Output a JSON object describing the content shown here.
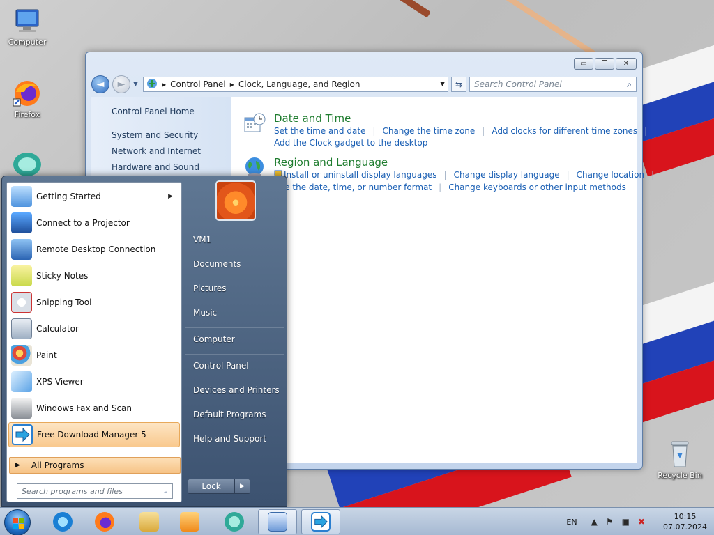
{
  "desktop": {
    "icons": [
      {
        "label": "Computer",
        "icon": "computer-monitor-icon"
      },
      {
        "label": "Firefox",
        "icon": "firefox-icon"
      },
      {
        "label": "Recycle Bin",
        "icon": "recycle-bin-icon"
      }
    ]
  },
  "window": {
    "caption_buttons": [
      "▭",
      "❐",
      "✕"
    ],
    "address": {
      "crumbs": [
        "Control Panel",
        "Clock, Language, and Region"
      ]
    },
    "search_placeholder": "Search Control Panel",
    "left_nav": [
      "Control Panel Home",
      "System and Security",
      "Network and Internet",
      "Hardware and Sound"
    ],
    "sections": [
      {
        "title": "Date and Time",
        "icon": "clock-calendar-icon",
        "rows": [
          [
            "Set the time and date",
            "Change the time zone",
            "Add clocks for different time zones"
          ],
          [
            "Add the Clock gadget to the desktop"
          ]
        ]
      },
      {
        "title": "Region and Language",
        "icon": "globe-icon",
        "rows": [
          [
            "Install or uninstall display languages",
            "Change display language",
            "Change location"
          ],
          [
            "nge the date, time, or number format",
            "Change keyboards or other input methods"
          ]
        ]
      }
    ]
  },
  "start_menu": {
    "programs": [
      {
        "label": "Getting Started",
        "has_submenu": true,
        "icon": "getting-started-icon"
      },
      {
        "label": "Connect to a Projector",
        "icon": "projector-icon"
      },
      {
        "label": "Remote Desktop Connection",
        "icon": "remote-desktop-icon"
      },
      {
        "label": "Sticky Notes",
        "icon": "sticky-notes-icon"
      },
      {
        "label": "Snipping Tool",
        "icon": "scissors-icon"
      },
      {
        "label": "Calculator",
        "icon": "calculator-icon"
      },
      {
        "label": "Paint",
        "icon": "paint-palette-icon"
      },
      {
        "label": "XPS Viewer",
        "icon": "xps-viewer-icon"
      },
      {
        "label": "Windows Fax and Scan",
        "icon": "fax-scanner-icon"
      },
      {
        "label": "Free Download Manager 5",
        "icon": "download-manager-icon",
        "highlighted": true
      }
    ],
    "all_programs": "All Programs",
    "search_placeholder": "Search programs and files",
    "right_items": [
      "VM1",
      "Documents",
      "Pictures",
      "Music",
      "Computer",
      "Control Panel",
      "Devices and Printers",
      "Default Programs",
      "Help and Support"
    ],
    "lock_label": "Lock"
  },
  "taskbar": {
    "pinned": [
      "internet-explorer-icon",
      "firefox-icon",
      "file-explorer-icon",
      "media-player-icon",
      "app-icon",
      "control-panel-icon",
      "download-manager-icon"
    ],
    "tray": {
      "language": "EN",
      "time": "10:15",
      "date": "07.07.2024"
    }
  }
}
